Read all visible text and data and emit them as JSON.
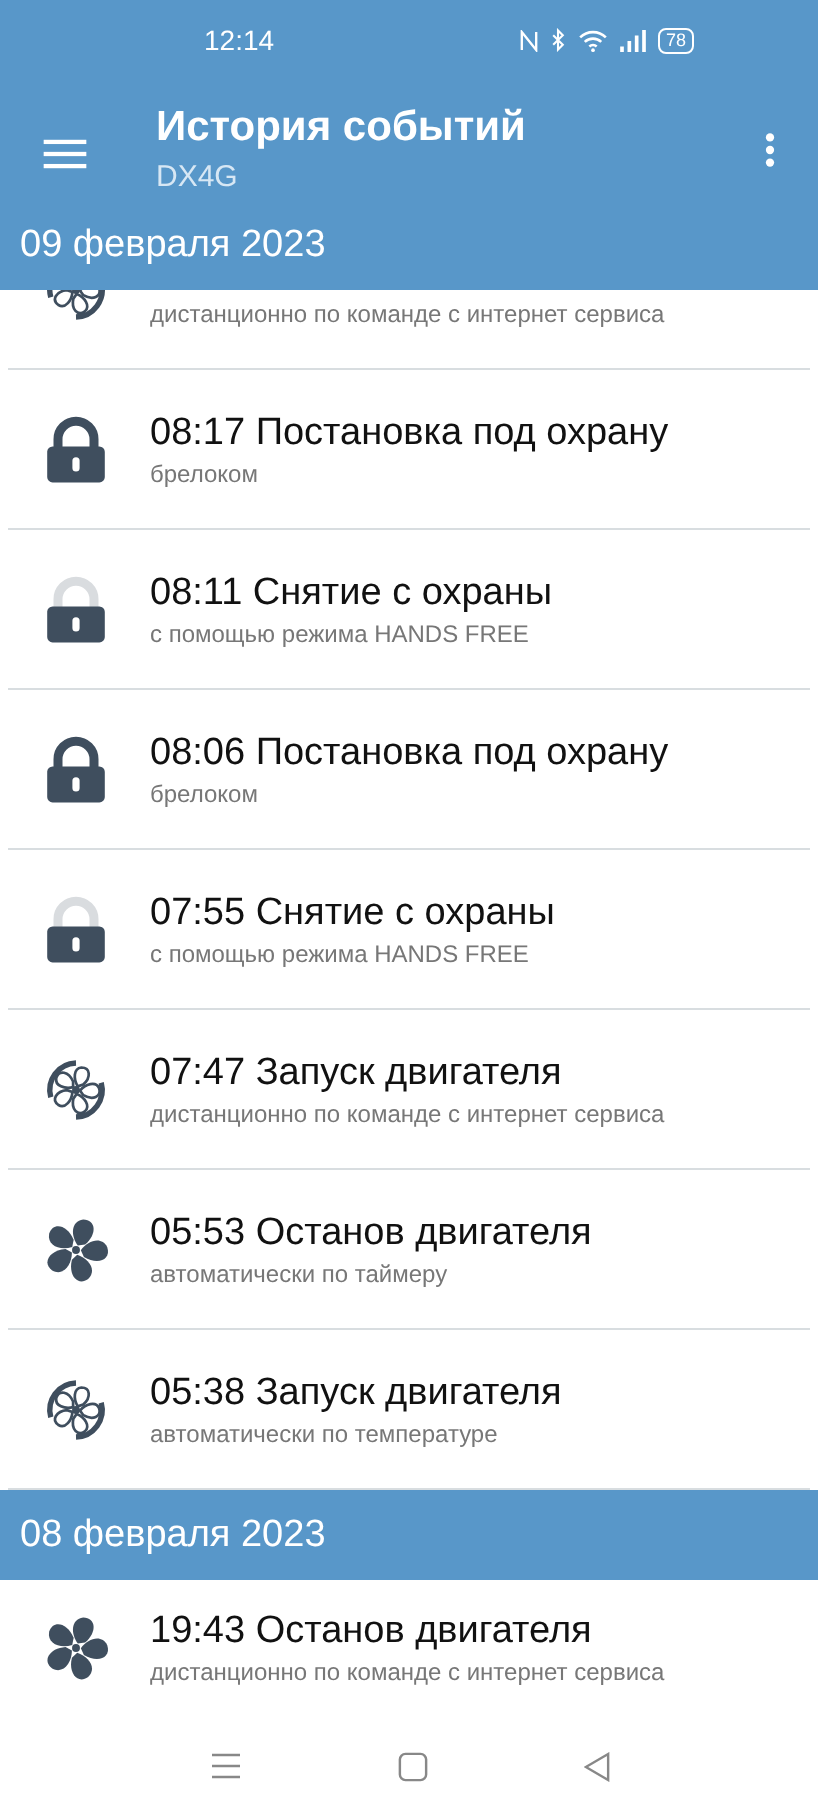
{
  "status_bar": {
    "time": "12:14",
    "battery": "78"
  },
  "app_bar": {
    "title": "История событий",
    "subtitle": "DX4G"
  },
  "sections": [
    {
      "date": "09 февраля 2023",
      "cut_item": {
        "kind": "engine_start",
        "subtitle": "дистанционно по команде с интернет сервиса"
      },
      "items": [
        {
          "kind": "arm",
          "title": "08:17 Постановка под охрану",
          "subtitle": "брелоком"
        },
        {
          "kind": "disarm",
          "title": "08:11 Снятие с охраны",
          "subtitle": "с помощью режима HANDS FREE"
        },
        {
          "kind": "arm",
          "title": "08:06 Постановка под охрану",
          "subtitle": "брелоком"
        },
        {
          "kind": "disarm",
          "title": "07:55 Снятие с охраны",
          "subtitle": "с помощью режима HANDS FREE"
        },
        {
          "kind": "engine_start",
          "title": "07:47 Запуск двигателя",
          "subtitle": "дистанционно по команде с интернет сервиса"
        },
        {
          "kind": "engine_stop",
          "title": "05:53 Останов двигателя",
          "subtitle": "автоматически по таймеру"
        },
        {
          "kind": "engine_start",
          "title": "05:38 Запуск двигателя",
          "subtitle": "автоматически по температуре"
        }
      ]
    },
    {
      "date": "08 февраля 2023",
      "items": [
        {
          "kind": "engine_stop",
          "title": "19:43 Останов двигателя",
          "subtitle": "дистанционно по команде с интернет сервиса"
        }
      ]
    }
  ]
}
